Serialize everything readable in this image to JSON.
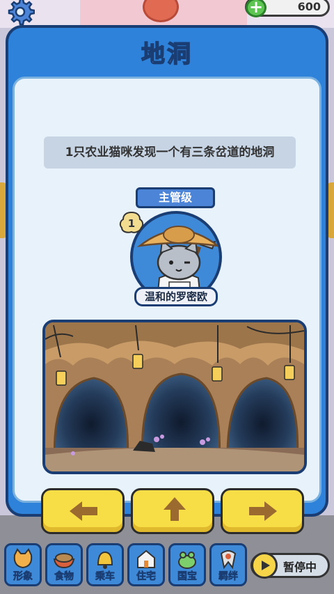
{
  "top_bar": {
    "currency_amount": "600",
    "icons": {
      "settings": "gear-icon",
      "add": "plus-icon",
      "avatar": "cat-avatar-icon"
    }
  },
  "modal": {
    "title": "地洞",
    "description": "1只农业猫咪发现一个有三条岔道的地洞",
    "rank_label": "主管级",
    "cat_level": "1",
    "cat_name": "温和的罗密欧",
    "direction_buttons": [
      {
        "name": "left",
        "icon": "arrow-left-icon"
      },
      {
        "name": "up",
        "icon": "arrow-up-icon"
      },
      {
        "name": "right",
        "icon": "arrow-right-icon"
      }
    ]
  },
  "bottom_nav": {
    "items": [
      {
        "label": "形象",
        "icon": "cat-face-icon"
      },
      {
        "label": "食物",
        "icon": "food-bowl-icon"
      },
      {
        "label": "乘车",
        "icon": "bell-icon"
      },
      {
        "label": "住宅",
        "icon": "house-icon"
      },
      {
        "label": "国宝",
        "icon": "frog-icon"
      },
      {
        "label": "羁绊",
        "icon": "ribbon-icon"
      }
    ],
    "pause_label": "暂停中"
  },
  "colors": {
    "modal_blue": "#2e82d9",
    "panel_bg": "#e7f2fb",
    "button_yellow": "#f7dd46",
    "outline_navy": "#1a3e74"
  }
}
